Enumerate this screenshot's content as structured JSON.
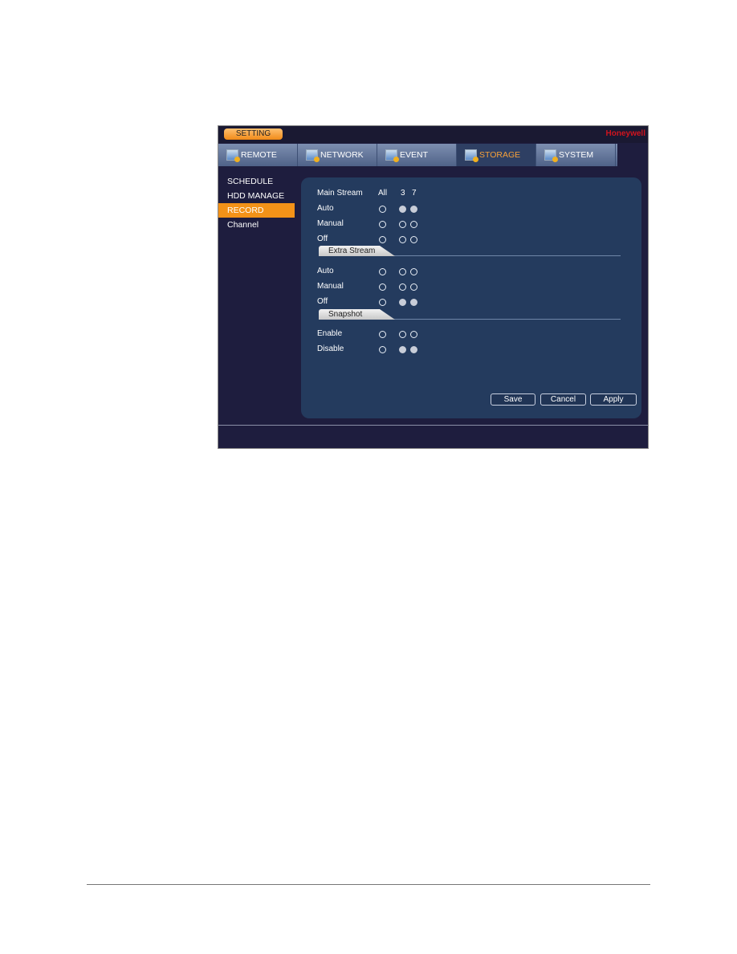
{
  "titlebar": {
    "setting": "SETTING",
    "brand": "Honeywell"
  },
  "tabs": [
    {
      "label": "REMOTE",
      "icon": "remote-icon"
    },
    {
      "label": "NETWORK",
      "icon": "network-icon"
    },
    {
      "label": "EVENT",
      "icon": "event-icon"
    },
    {
      "label": "STORAGE",
      "icon": "storage-icon",
      "active": true
    },
    {
      "label": "SYSTEM",
      "icon": "system-icon"
    }
  ],
  "sidebar": [
    "SCHEDULE",
    "HDD MANAGE",
    "RECORD",
    "Channel"
  ],
  "sidebar_active": "RECORD",
  "main": {
    "header": "Main Stream",
    "columns": [
      "All",
      "3",
      "7"
    ],
    "main_rows": [
      {
        "label": "Auto",
        "values": [
          false,
          true,
          true
        ]
      },
      {
        "label": "Manual",
        "values": [
          false,
          false,
          false
        ]
      },
      {
        "label": "Off",
        "values": [
          false,
          false,
          false
        ]
      }
    ],
    "extra_title": "Extra Stream",
    "extra_rows": [
      {
        "label": "Auto",
        "values": [
          false,
          false,
          false
        ]
      },
      {
        "label": "Manual",
        "values": [
          false,
          false,
          false
        ]
      },
      {
        "label": "Off",
        "values": [
          false,
          true,
          true
        ]
      }
    ],
    "snapshot_title": "Snapshot",
    "snapshot_rows": [
      {
        "label": "Enable",
        "values": [
          false,
          false,
          false
        ]
      },
      {
        "label": "Disable",
        "values": [
          false,
          true,
          true
        ]
      }
    ]
  },
  "buttons": {
    "save": "Save",
    "cancel": "Cancel",
    "apply": "Apply"
  }
}
